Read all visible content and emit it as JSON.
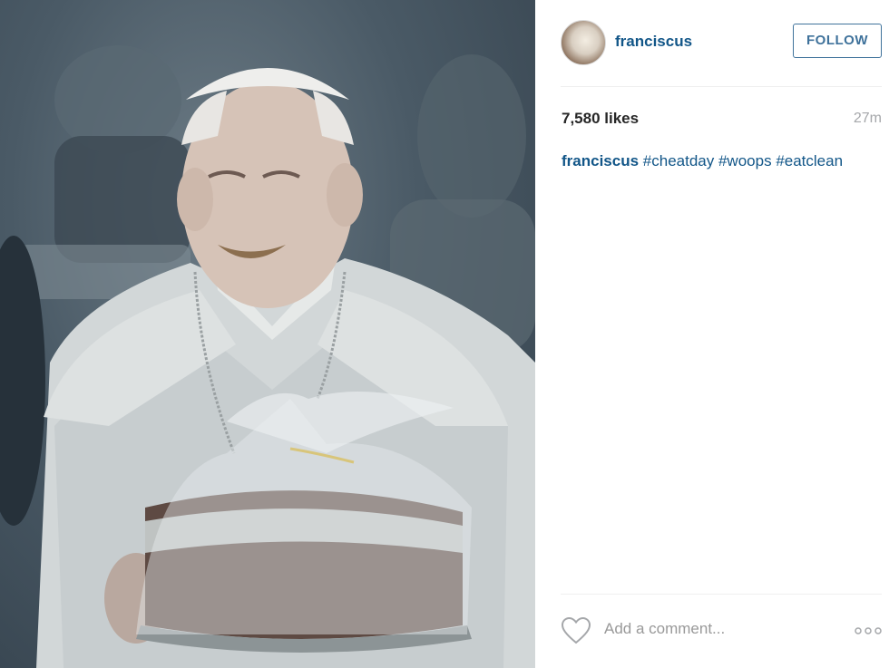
{
  "post": {
    "username": "franciscus",
    "follow_label": "FOLLOW",
    "likes": "7,580 likes",
    "time": "27m",
    "caption_user": "franciscus",
    "hashtags": [
      "#cheatday",
      "#woops",
      "#eatclean"
    ]
  },
  "comment": {
    "placeholder": "Add a comment..."
  },
  "icons": {
    "like": "heart-icon",
    "more": "more-options-icon"
  },
  "colors": {
    "link": "#125688",
    "follow_border": "#3f729b"
  }
}
